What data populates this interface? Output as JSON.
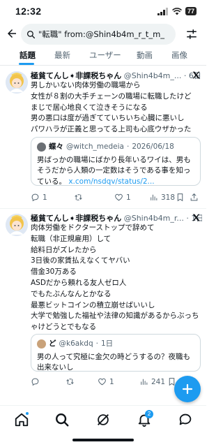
{
  "status_bar": {
    "time": "12:32",
    "battery": "77"
  },
  "search": {
    "query": "\"転職\" from:@Shin4b4m_r_t_m_"
  },
  "tabs": [
    {
      "label": "話題",
      "active": true
    },
    {
      "label": "最新",
      "active": false
    },
    {
      "label": "ユーザー",
      "active": false
    },
    {
      "label": "動画",
      "active": false
    },
    {
      "label": "画像",
      "active": false
    }
  ],
  "tweets": [
    {
      "author_name": "極貧てんし➧非課税ちゃん",
      "author_handle": "@Shin4b4m_...",
      "time_sep": " · ",
      "time": "6日",
      "lines": [
        "男しかいない肉体労働の職場から",
        "女性が８割の大手チェーンの職場に転職したけど",
        "まじで居心地良くて泣きそうになる",
        "男の悪口は度が過ぎてていちいち心臓に悪いし",
        "パワハラが正義と思ってる上司も心底ウザかった"
      ],
      "quote": {
        "name": "蝶々",
        "handle": "@witch_medeia",
        "date_sep": " · ",
        "date": "2026/06/18",
        "lines": [
          "男ばっかの職場にばかり長年いるワイは、男も",
          "そうだから人類の一定数はそうである事を知っ"
        ],
        "last_line_text": "ている。",
        "link": "x.com/nsdqv/status/2..."
      },
      "actions": {
        "replies": "1",
        "retweets": "",
        "likes": "1",
        "views": "318"
      }
    },
    {
      "author_name": "極貧てんし➧非課税ちゃん",
      "author_handle": "@Shin4b4m_r...",
      "time_sep": " · ",
      "time": "1日",
      "lines": [
        "肉体労働をドクターストップで辞めて",
        "転職（非正規雇用）して",
        "給料日がズレたから",
        "3日後の家賃払えなくてヤバい",
        "借金30万ある",
        "ASDだから頼れる友人ゼロ人",
        "でもたぶんなんとかなる",
        "最悪ビットコインの積立崩せばいいし",
        "大学で勉強した福祉や法律の知識があるからぶっち",
        "ゃけどうとでもなる"
      ],
      "quote": {
        "name": "ど",
        "handle": "@k6akdq",
        "date_sep": " · ",
        "date": "1日",
        "lines": [
          "男の人って究極に金欠の時どうするの？夜職も",
          "出来ないし"
        ]
      },
      "actions": {
        "replies": "",
        "retweets": "",
        "likes": "1",
        "views": "241"
      }
    }
  ],
  "nav": {
    "items": [
      "home-icon",
      "search-icon",
      "grok-icon",
      "notifications-icon",
      "messages-icon"
    ],
    "notification_count": "2"
  },
  "colors": {
    "accent": "#1d9bf0",
    "text": "#0f1419",
    "muted": "#536471"
  }
}
